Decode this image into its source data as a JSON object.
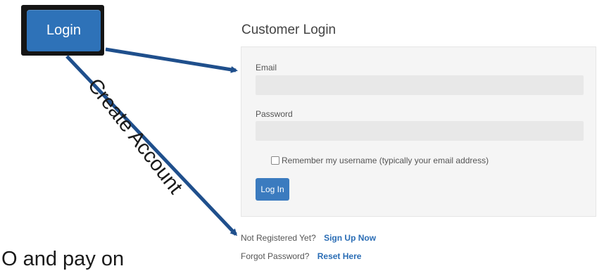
{
  "header": {
    "login_label": "Login"
  },
  "annotation": {
    "create_account": "Create Account",
    "bottom_text": "O and pay on"
  },
  "panel": {
    "title": "Customer Login",
    "email_label": "Email",
    "email_value": "",
    "password_label": "Password",
    "password_value": "",
    "remember_label": "Remember my username (typically your email address)",
    "remember_checked": false,
    "submit_label": "Log In"
  },
  "links": {
    "register_prompt": "Not Registered Yet?",
    "register_link": "Sign Up Now",
    "forgot_prompt": "Forgot Password?",
    "forgot_link": "Reset Here"
  },
  "colors": {
    "accent": "#2e72b8",
    "arrow": "#1f4f8c",
    "panel_bg": "#f5f5f5"
  }
}
